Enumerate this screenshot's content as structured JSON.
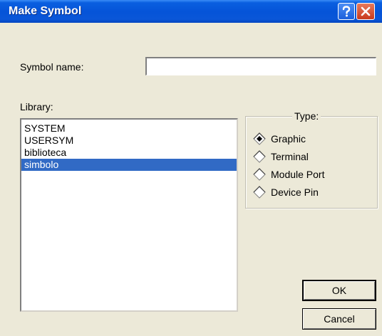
{
  "window": {
    "title": "Make Symbol"
  },
  "titlebar": {
    "help_icon": "question-mark-icon",
    "close_icon": "close-x-icon"
  },
  "colors": {
    "titlebar": "#0554d8",
    "selection": "#316ac5",
    "dialog_bg": "#ece9d8"
  },
  "symbol_name": {
    "label": "Symbol name:",
    "value": "",
    "placeholder": ""
  },
  "library": {
    "label": "Library:",
    "items": [
      "SYSTEM",
      "USERSYM",
      "biblioteca",
      "simbolo"
    ],
    "selected": "simbolo"
  },
  "type": {
    "label": "Type:",
    "options": [
      "Graphic",
      "Terminal",
      "Module Port",
      "Device Pin"
    ],
    "selected": "Graphic"
  },
  "buttons": {
    "ok": "OK",
    "cancel": "Cancel"
  }
}
